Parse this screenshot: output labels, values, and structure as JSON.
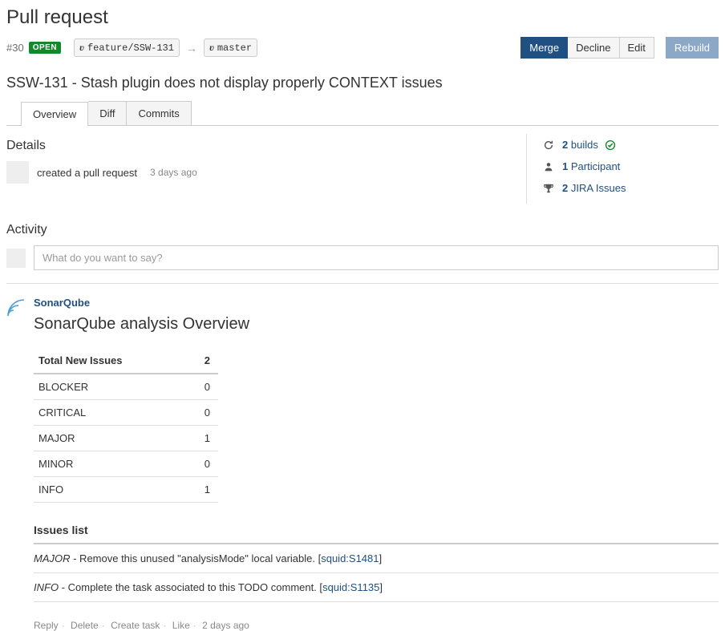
{
  "header": {
    "page_title": "Pull request",
    "pr_id": "#30",
    "status_badge": "OPEN",
    "source_branch": "feature/SSW-131",
    "target_branch": "master",
    "buttons": {
      "merge": "Merge",
      "decline": "Decline",
      "edit": "Edit",
      "rebuild": "Rebuild"
    },
    "pr_title": "SSW-131 - Stash plugin does not display properly CONTEXT issues"
  },
  "tabs": {
    "overview": "Overview",
    "diff": "Diff",
    "commits": "Commits"
  },
  "details": {
    "heading": "Details",
    "event_text": "created a pull request",
    "event_time": "3 days ago"
  },
  "sidebar": {
    "builds": {
      "count": "2",
      "label": "builds"
    },
    "participants": {
      "count": "1",
      "label": "Participant"
    },
    "jira": {
      "count": "2",
      "label": "JIRA Issues"
    }
  },
  "activity": {
    "heading": "Activity",
    "placeholder": "What do you want to say?"
  },
  "sonarqube": {
    "author": "SonarQube",
    "title": "SonarQube analysis Overview",
    "summary_header": "Total New Issues",
    "summary_total": "2",
    "rows": [
      {
        "label": "BLOCKER",
        "value": "0"
      },
      {
        "label": "CRITICAL",
        "value": "0"
      },
      {
        "label": "MAJOR",
        "value": "1"
      },
      {
        "label": "MINOR",
        "value": "0"
      },
      {
        "label": "INFO",
        "value": "1"
      }
    ],
    "issues_list_heading": "Issues list",
    "issues": [
      {
        "severity": "MAJOR",
        "text": " - Remove this unused \"analysisMode\" local variable. [",
        "rule": "squid:S1481",
        "close": "]"
      },
      {
        "severity": "INFO",
        "text": " - Complete the task associated to this TODO comment. [",
        "rule": "squid:S1135",
        "close": "]"
      }
    ],
    "actions": {
      "reply": "Reply",
      "delete": "Delete",
      "create_task": "Create task",
      "like": "Like",
      "time": "2 days ago"
    }
  }
}
